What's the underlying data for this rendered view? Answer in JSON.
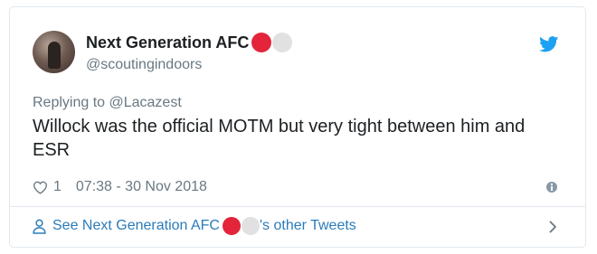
{
  "author": {
    "name": "Next Generation AFC",
    "handle": "@scoutingindoors"
  },
  "tweet": {
    "replying_to": "Replying to @Lacazest",
    "text": "Willock was the official MOTM but very tight between him and ESR",
    "likes": "1",
    "timestamp": "07:38 - 30 Nov 2018"
  },
  "footer": {
    "prefix": "See Next Generation AFC",
    "suffix": "'s other Tweets"
  },
  "icons": {
    "avatar": "avatar",
    "brand": "twitter-bird-icon",
    "like": "heart-icon",
    "info": "info-icon",
    "profile": "person-icon",
    "more": "chevron-right-icon"
  },
  "colors": {
    "accent": "#1da1f2",
    "link": "#2b7bb9",
    "emoji_red": "#e3243b",
    "emoji_white": "#e1e1e1"
  }
}
